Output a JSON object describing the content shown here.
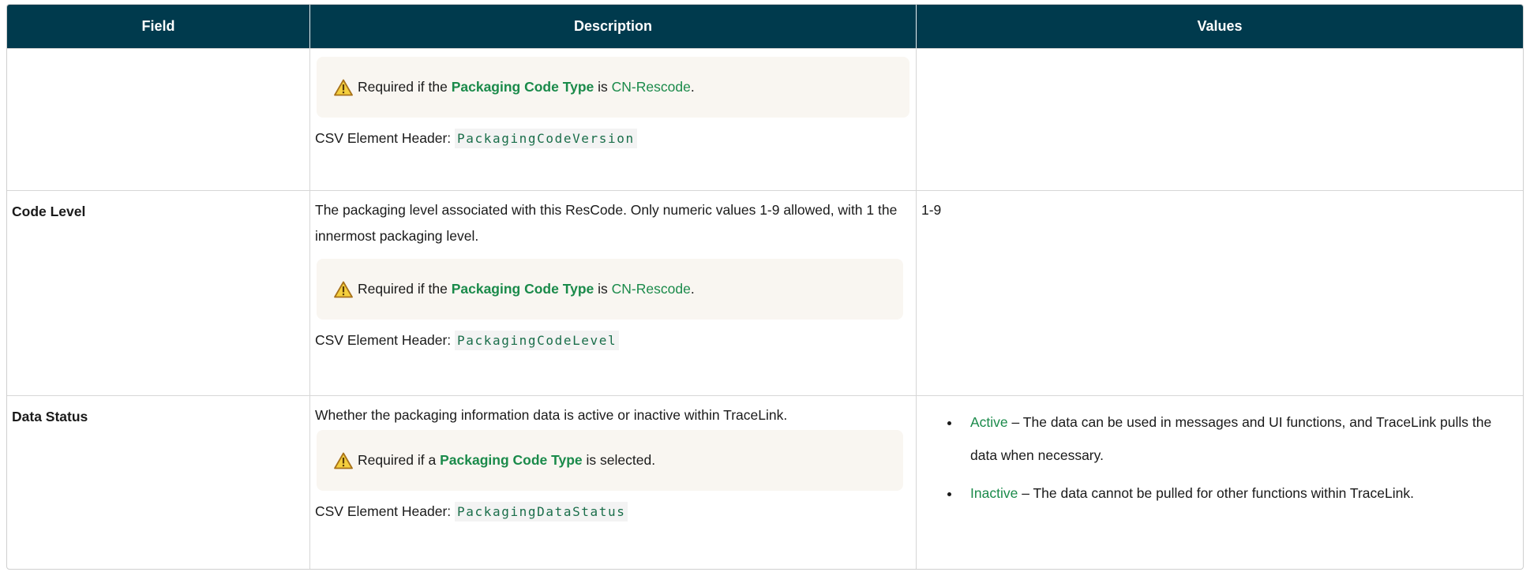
{
  "header": {
    "col_field": "Field",
    "col_description": "Description",
    "col_values": "Values"
  },
  "rows": [
    {
      "field": "",
      "description": "",
      "note": {
        "pre": "Required if the",
        "link": "Packaging Code Type",
        "mid": "is",
        "value": "CN-Rescode",
        "post": "."
      },
      "csv_label": "CSV Element Header:",
      "csv_code": "PackagingCodeVersion",
      "values": ""
    },
    {
      "field": "Code Level",
      "description": "The packaging level associated with this ResCode. Only numeric values 1-9 allowed, with 1 the innermost packaging level.",
      "note": {
        "pre": "Required if the",
        "link": "Packaging Code Type",
        "mid": "is",
        "value": "CN-Rescode",
        "post": "."
      },
      "csv_label": "CSV Element Header:",
      "csv_code": "PackagingCodeLevel",
      "values": "1-9"
    },
    {
      "field": "Data Status",
      "description": "Whether the packaging information data is active or inactive within TraceLink.",
      "note": {
        "pre": "Required if a",
        "link": "Packaging Code Type",
        "post": "is selected."
      },
      "csv_label": "CSV Element Header:",
      "csv_code": "PackagingDataStatus",
      "value_items": [
        {
          "term": "Active",
          "text": "– The data can be used in messages and UI functions, and TraceLink pulls the data when necessary."
        },
        {
          "term": "Inactive",
          "text": "– The data cannot be pulled for other functions within TraceLink."
        }
      ]
    }
  ],
  "colors": {
    "header_bg": "#003a4d",
    "link_green": "#1a8a4a",
    "note_bg": "#f9f6f1",
    "warn": "#d9a520"
  },
  "icons": {
    "warning": "warning-triangle-icon"
  }
}
